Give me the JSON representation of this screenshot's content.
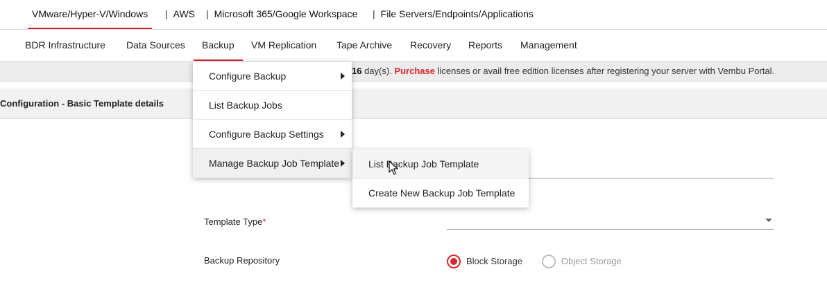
{
  "platform_tabs": [
    {
      "label": "VMware/Hyper-V/Windows",
      "active": true
    },
    {
      "label": "AWS",
      "active": false
    },
    {
      "label": "Microsoft 365/Google Workspace",
      "active": false
    },
    {
      "label": "File Servers/Endpoints/Applications",
      "active": false
    }
  ],
  "separator": "|",
  "main_nav": [
    {
      "label": "BDR Infrastructure"
    },
    {
      "label": "Data Sources"
    },
    {
      "label": "Backup",
      "active": true
    },
    {
      "label": "VM Replication"
    },
    {
      "label": "Tape Archive"
    },
    {
      "label": "Recovery"
    },
    {
      "label": "Reports"
    },
    {
      "label": "Management"
    }
  ],
  "banner": {
    "days": "16",
    "days_suffix": " day(s). ",
    "purchase": "Purchase",
    "rest": " licenses or avail free edition licenses after registering your server with Vembu Portal."
  },
  "section": {
    "title": "Configuration - Basic Template details"
  },
  "form": {
    "template_type_label": "Template Type",
    "required_mark": "*",
    "backup_repository_label": "Backup Repository",
    "repository_options": [
      {
        "label": "Block Storage",
        "selected": true
      },
      {
        "label": "Object Storage",
        "selected": false
      }
    ]
  },
  "backup_menu": {
    "items": [
      {
        "label": "Configure Backup",
        "has_submenu": true
      },
      {
        "label": "List Backup Jobs",
        "has_submenu": false
      },
      {
        "label": "Configure Backup Settings",
        "has_submenu": true
      },
      {
        "label": "Manage Backup Job Template",
        "has_submenu": true
      }
    ]
  },
  "template_submenu": {
    "items": [
      {
        "label": "List Backup Job Template",
        "hovered": true
      },
      {
        "label": "Create New Backup Job Template"
      }
    ]
  },
  "colors": {
    "accent": "#d9262b",
    "banner_bg": "#ececec",
    "section_bg": "#f1f1f1"
  }
}
